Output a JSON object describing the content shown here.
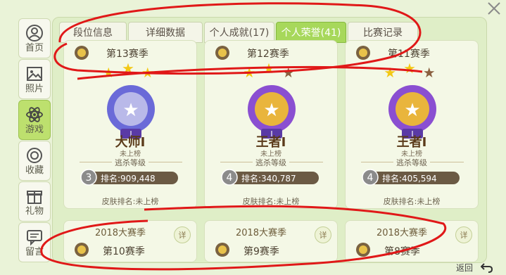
{
  "nav": {
    "items": [
      {
        "label": "首页",
        "icon": "person-icon",
        "active": false
      },
      {
        "label": "照片",
        "icon": "photo-icon",
        "active": false
      },
      {
        "label": "游戏",
        "icon": "atom-icon",
        "active": true
      },
      {
        "label": "收藏",
        "icon": "ring-icon",
        "active": false
      },
      {
        "label": "礼物",
        "icon": "gift-icon",
        "active": false
      },
      {
        "label": "留言",
        "icon": "message-icon",
        "active": false
      }
    ]
  },
  "tabs": [
    {
      "label": "段位信息",
      "active": false
    },
    {
      "label": "详细数据",
      "active": false
    },
    {
      "label": "个人成就(17)",
      "active": false
    },
    {
      "label": "个人荣誉(41)",
      "active": true
    },
    {
      "label": "比赛记录",
      "active": false
    }
  ],
  "cards": [
    {
      "season": "第13赛季",
      "rank": "大师Ⅰ",
      "leaderboard": "未上榜",
      "tag": "逃杀等级",
      "level_num": "3",
      "rank_label": "排名:909,448",
      "skin": "皮肤排名:未上榜",
      "badge": "silver"
    },
    {
      "season": "第12赛季",
      "rank": "王者Ⅰ",
      "leaderboard": "未上榜",
      "tag": "逃杀等级",
      "level_num": "4",
      "rank_label": "排名:340,787",
      "skin": "皮肤排名:未上榜",
      "badge": "gold"
    },
    {
      "season": "第11赛季",
      "rank": "王者Ⅰ",
      "leaderboard": "未上榜",
      "tag": "逃杀等级",
      "level_num": "4",
      "rank_label": "排名:405,594",
      "skin": "皮肤排名:未上榜",
      "badge": "gold"
    }
  ],
  "lower_cards": [
    {
      "title": "2018大赛季",
      "season": "第10赛季",
      "detail": "详"
    },
    {
      "title": "2018大赛季",
      "season": "第9赛季",
      "detail": "详"
    },
    {
      "title": "2018大赛季",
      "season": "第8赛季",
      "detail": "详"
    }
  ],
  "back_label": "返回",
  "colors": {
    "accent": "#a7d85b",
    "panel": "#dfeec7",
    "scribble": "#e01818"
  }
}
